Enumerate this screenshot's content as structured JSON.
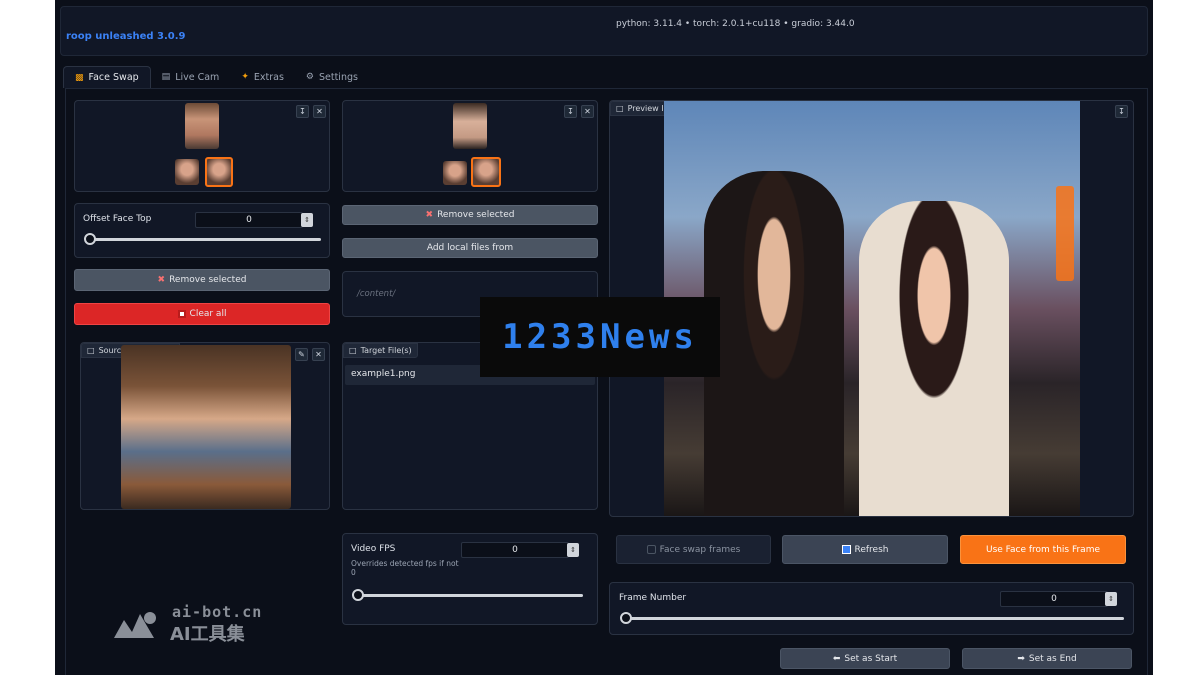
{
  "app": {
    "title": "roop unleashed 3.0.9",
    "versions": "python: 3.11.4  •  torch: 2.0.1+cu118  •  gradio: 3.44.0"
  },
  "tabs": [
    {
      "label": "Face Swap",
      "icon": "face-swap-icon",
      "active": true
    },
    {
      "label": "Live Cam",
      "icon": "camera-icon",
      "active": false
    },
    {
      "label": "Extras",
      "icon": "extras-icon",
      "active": false
    },
    {
      "label": "Settings",
      "icon": "gear-icon",
      "active": false
    }
  ],
  "left": {
    "offset_label": "Offset Face Top",
    "offset_value": "0",
    "offset_fraction": 0,
    "remove_selected": "Remove selected",
    "clear_all": "Clear all",
    "source_face_label": "Source Face Image"
  },
  "middle": {
    "remove_selected": "Remove selected",
    "add_local": "Add local files from",
    "path_placeholder": "/content/",
    "target_label": "Target File(s)",
    "target_file": "example1.png",
    "fps_label": "Video FPS",
    "fps_value": "0",
    "fps_note": "Overrides detected fps if not 0",
    "fps_fraction": 0
  },
  "right": {
    "preview_label": "Preview Image",
    "face_swap_frames": "Face swap frames",
    "refresh": "Refresh",
    "use_face": "Use Face from this Frame",
    "frame_number_label": "Frame Number",
    "frame_number_value": "0",
    "frame_fraction": 0,
    "set_start": "Set as Start",
    "set_end": "Set as End"
  },
  "watermarks": {
    "main": "1233News",
    "domain": "ai-bot.cn",
    "name": "AI工具集"
  },
  "colors": {
    "accent_blue": "#3b82f6",
    "danger_red": "#dc2626",
    "orange": "#f97316",
    "bg": "#0b0f19"
  }
}
